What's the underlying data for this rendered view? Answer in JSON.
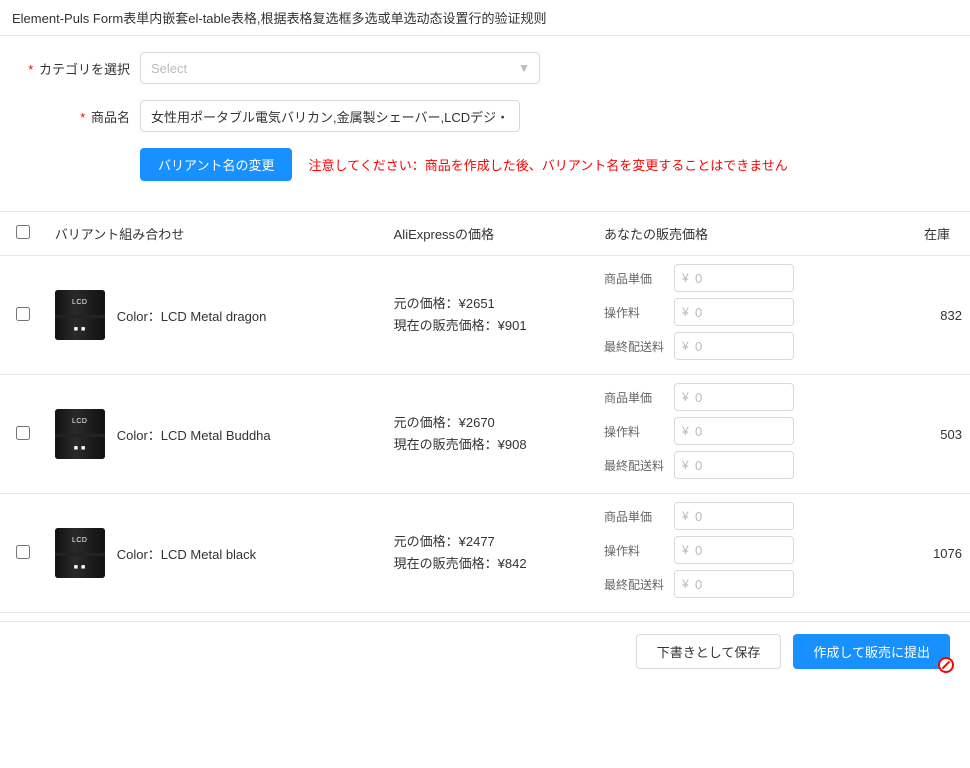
{
  "page": {
    "title": "Element-Puls Form表単内嵌套el-table表格,根据表格复选框多选或单选动态设置行的验证规则"
  },
  "form": {
    "category_label": "カテゴリを選択",
    "category_placeholder": "Select",
    "product_name_label": "商品名",
    "product_name_value": "女性用ポータブル電気バリカン,金属製シェーバー,LCDデジ・",
    "change_variant_btn": "バリアント名の変更",
    "warning_prefix": "注意してください：",
    "warning_text": "商品を作成した後、バリアント名を変更することはできません"
  },
  "table": {
    "headers": {
      "variant": "バリアント組み合わせ",
      "ali_price": "AliExpressの価格",
      "sell_price": "あなたの販売価格",
      "stock": "在庫"
    },
    "price_labels": {
      "unit": "商品単価",
      "handling": "操作料",
      "shipping": "最終配送料"
    },
    "rows": [
      {
        "id": 1,
        "variant": "Color：LCD Metal dragon",
        "original_price_label": "元の価格：",
        "original_price": "¥2651",
        "current_price_label": "現在の販売価格：",
        "current_price": "¥901",
        "unit_price": "0",
        "handling_fee": "0",
        "shipping_fee": "0",
        "stock": "832"
      },
      {
        "id": 2,
        "variant": "Color：LCD Metal Buddha",
        "original_price_label": "元の価格：",
        "original_price": "¥2670",
        "current_price_label": "現在の販売価格：",
        "current_price": "¥908",
        "unit_price": "0",
        "handling_fee": "0",
        "shipping_fee": "0",
        "stock": "503"
      },
      {
        "id": 3,
        "variant": "Color：LCD Metal black",
        "original_price_label": "元の価格：",
        "original_price": "¥2477",
        "current_price_label": "現在の販売価格：",
        "current_price": "¥842",
        "unit_price": "0",
        "handling_fee": "0",
        "shipping_fee": "0",
        "stock": "1076"
      }
    ]
  },
  "footer": {
    "draft_btn": "下書きとして保存",
    "submit_btn": "作成して販売に提出"
  }
}
